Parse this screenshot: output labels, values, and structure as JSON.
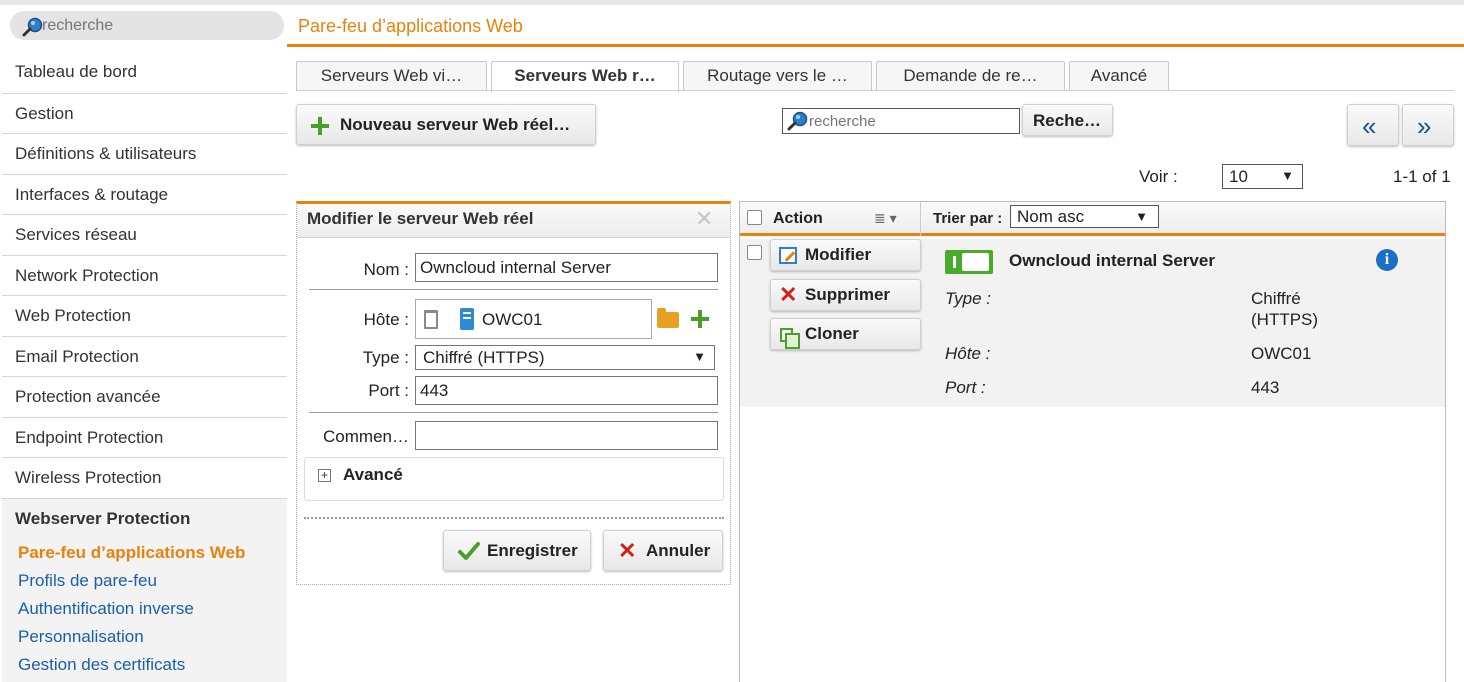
{
  "sidebar": {
    "search_placeholder": "recherche",
    "items": [
      {
        "label": "Tableau de bord"
      },
      {
        "label": "Gestion"
      },
      {
        "label": "Définitions & utilisateurs"
      },
      {
        "label": "Interfaces & routage"
      },
      {
        "label": "Services réseau"
      },
      {
        "label": "Network Protection"
      },
      {
        "label": "Web Protection"
      },
      {
        "label": "Email Protection"
      },
      {
        "label": "Protection avancée"
      },
      {
        "label": "Endpoint Protection"
      },
      {
        "label": "Wireless Protection"
      }
    ],
    "group": {
      "title": "Webserver Protection",
      "items": [
        {
          "label": "Pare-feu d’applications Web",
          "active": true
        },
        {
          "label": "Profils de pare-feu"
        },
        {
          "label": "Authentification inverse"
        },
        {
          "label": "Personnalisation"
        },
        {
          "label": "Gestion des certificats"
        }
      ]
    }
  },
  "header": {
    "title": "Pare-feu d’applications Web"
  },
  "tabs": [
    {
      "label": "Serveurs Web vi…"
    },
    {
      "label": "Serveurs Web r…",
      "active": true
    },
    {
      "label": "Routage vers le …"
    },
    {
      "label": "Demande de re…"
    },
    {
      "label": "Avancé"
    }
  ],
  "toolbar": {
    "new_label": "Nouveau serveur Web réel…",
    "search_placeholder": "recherche",
    "search_button": "Reche…",
    "prev": "«",
    "next": "»",
    "voir_label": "Voir :",
    "voir_value": "10",
    "count": "1-1 of 1"
  },
  "edit": {
    "title": "Modifier le serveur Web réel",
    "close": "✕",
    "name_label": "Nom :",
    "name_value": "Owncloud internal Server",
    "host_label": "Hôte :",
    "host_value": "OWC01",
    "type_label": "Type :",
    "type_value": "Chiffré (HTTPS)",
    "port_label": "Port :",
    "port_value": "443",
    "comment_label": "Commen…",
    "comment_value": "",
    "advanced_label": "Avancé",
    "save_label": "Enregistrer",
    "cancel_label": "Annuler"
  },
  "list": {
    "action_header": "Action",
    "sort_label": "Trier par :",
    "sort_value": "Nom asc",
    "row": {
      "modify": "Modifier",
      "delete": "Supprimer",
      "clone": "Cloner",
      "name": "Owncloud internal Server",
      "type_label": "Type :",
      "type_value": "Chiffré (HTTPS)",
      "host_label": "Hôte :",
      "host_value": "OWC01",
      "port_label": "Port :",
      "port_value": "443",
      "enabled": true
    }
  },
  "colors": {
    "accent": "#e8820c",
    "link": "#1a5ea8",
    "ok": "#4a9e2a",
    "danger": "#d0201a"
  }
}
